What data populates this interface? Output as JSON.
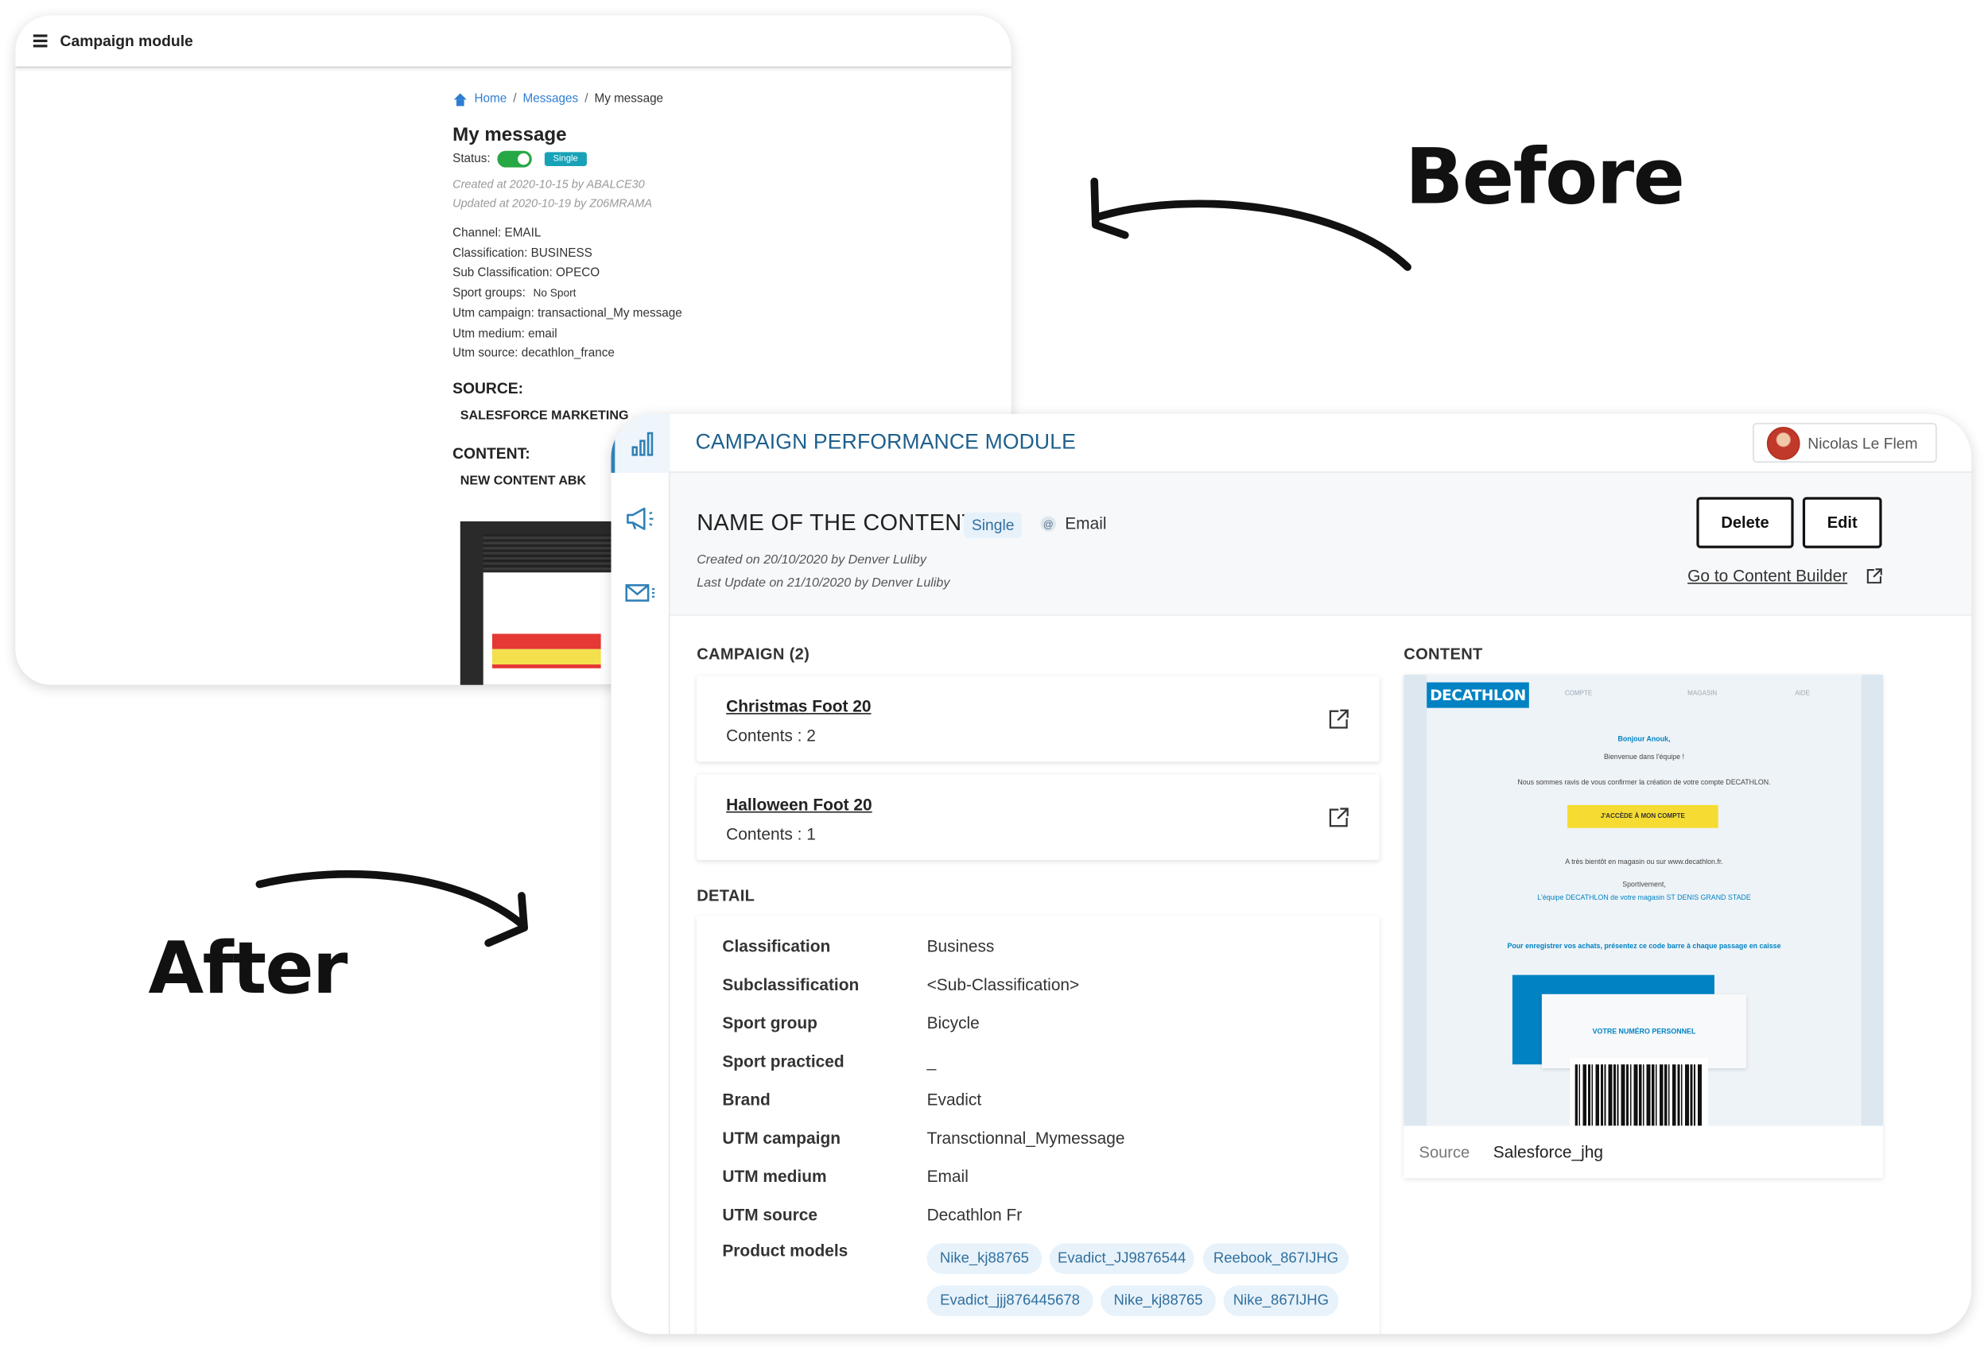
{
  "before": {
    "app_title": "Campaign module",
    "breadcrumb": {
      "home": "Home",
      "messages": "Messages",
      "current": "My message"
    },
    "heading": "My message",
    "status_label": "Status:",
    "status_badge": "Single",
    "created": "Created at 2020-10-15 by ABALCE30",
    "updated": "Updated at 2020-10-19 by Z06MRAMA",
    "channel": "Channel: EMAIL",
    "classification": "Classification: BUSINESS",
    "sub_classification": "Sub Classification: OPECO",
    "sport_groups_label": "Sport groups:",
    "sport_groups_value": "No Sport",
    "utm_campaign": "Utm campaign: transactional_My message",
    "utm_medium": "Utm medium: email",
    "utm_source": "Utm source: decathlon_france",
    "source_heading": "SOURCE:",
    "source_value": "SALESFORCE MARKETING",
    "content_heading": "CONTENT:",
    "content_value": "NEW CONTENT ABK"
  },
  "annotations": {
    "before": "Before",
    "after": "After"
  },
  "after": {
    "app_title": "CAMPAIGN PERFORMANCE MODULE",
    "user_name": "Nicolas Le Flem",
    "content_name": "NAME OF THE CONTENT",
    "type_badge": "Single",
    "channel": "Email",
    "created": "Created on 20/10/2020 by Denver Luliby",
    "updated": "Last Update on  21/10/2020 by Denver Luliby",
    "delete_label": "Delete",
    "edit_label": "Edit",
    "builder_link": "Go to Content Builder",
    "campaign_heading": "CAMPAIGN (2)",
    "campaigns": [
      {
        "name": "Christmas Foot 20",
        "contents": "Contents : 2"
      },
      {
        "name": "Halloween Foot 20",
        "contents": "Contents : 1"
      }
    ],
    "detail_heading": "DETAIL",
    "detail": [
      {
        "key": "Classification",
        "value": "Business"
      },
      {
        "key": "Subclassification",
        "value": "<Sub-Classification>"
      },
      {
        "key": "Sport group",
        "value": "Bicycle"
      },
      {
        "key": "Sport practiced",
        "value": "_"
      },
      {
        "key": "Brand",
        "value": "Evadict"
      },
      {
        "key": "UTM campaign",
        "value": "Transctionnal_Mymessage"
      },
      {
        "key": "UTM medium",
        "value": "Email"
      },
      {
        "key": "UTM source",
        "value": "Decathlon Fr"
      },
      {
        "key": "Product models",
        "value": ""
      }
    ],
    "product_models": [
      "Nike_kj88765",
      "Evadict_JJ9876544",
      "Reebook_867IJHG",
      "Evadict_jjj876445678",
      "Nike_kj88765",
      "Nike_867IJHG"
    ],
    "content_heading": "CONTENT",
    "source_label": "Source",
    "source_value": "Salesforce_jhg",
    "email": {
      "logo": "DECATHLON",
      "nav": [
        "COMPTE",
        "MAGASIN",
        "AIDE"
      ],
      "greeting": "Bonjour Anouk,",
      "welcome": "Bienvenue dans l'équipe !",
      "confirm": "Nous sommes ravis de vous confirmer la création de votre compte DECATHLON.",
      "cta": "J'ACCÈDE À MON COMPTE",
      "soon": "A très bientôt en magasin ou sur www.decathlon.fr.",
      "sport": "Sportivement,",
      "team": "L'équipe DECATHLON de votre magasin ST DENIS GRAND STADE",
      "register": "Pour enregistrer vos achats, présentez ce code barre à chaque passage en caisse",
      "card_label": "VOTRE NUMÉRO PERSONNEL"
    }
  }
}
